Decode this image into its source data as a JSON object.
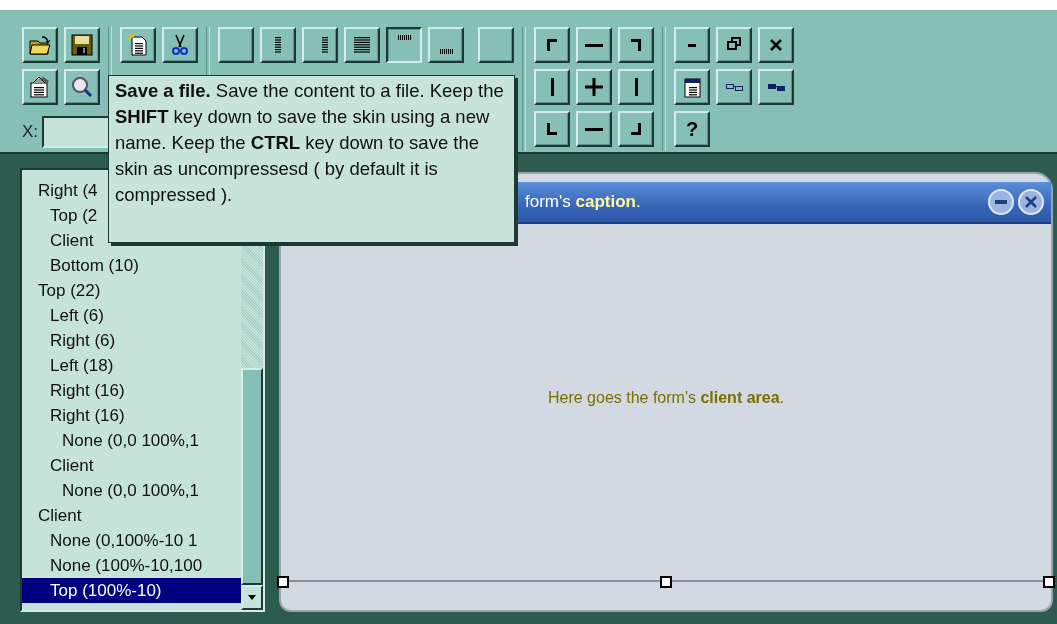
{
  "toolbar": {
    "alignment_buttons": [
      {
        "selected": false
      },
      {
        "selected": false
      },
      {
        "selected": false
      },
      {
        "selected": false
      },
      {
        "selected": true
      },
      {
        "selected": false
      }
    ],
    "coordinate_label": "X:",
    "help_button": "?"
  },
  "tooltip": {
    "text": "**Save a file.** Save the content to a file. Keep the **SHIFT** key down to save the skin using a new name. Keep the **CTRL** key down to save the skin as uncompressesd ( by default it is compressed )."
  },
  "tree": {
    "items": [
      {
        "label": "Right (4",
        "selected": false,
        "children": [
          {
            "label": "Top (2",
            "selected": false
          },
          {
            "label": "Client",
            "selected": false
          },
          {
            "label": "Bottom (10)",
            "selected": false
          }
        ]
      },
      {
        "label": "Top (22)",
        "selected": false,
        "children": [
          {
            "label": "Left (6)",
            "selected": false
          },
          {
            "label": "Right (6)",
            "selected": false
          },
          {
            "label": "Left (18)",
            "selected": false
          },
          {
            "label": "Right (16)",
            "selected": false
          },
          {
            "label": "Right (16)",
            "selected": false,
            "children": [
              {
                "label": "None (0,0 100%,1",
                "selected": false
              }
            ]
          },
          {
            "label": "Client",
            "selected": false,
            "children": [
              {
                "label": "None (0,0 100%,1",
                "selected": false
              }
            ]
          }
        ]
      },
      {
        "label": "Client",
        "selected": false,
        "children": [
          {
            "label": "None (0,100%-10 1",
            "selected": false
          },
          {
            "label": "None (100%-10,100",
            "selected": false
          },
          {
            "label": "Top (100%-10)",
            "selected": true
          }
        ]
      }
    ]
  },
  "form_preview": {
    "caption": "form's **caption**.",
    "client_text": "Here goes the form's **client area**."
  }
}
